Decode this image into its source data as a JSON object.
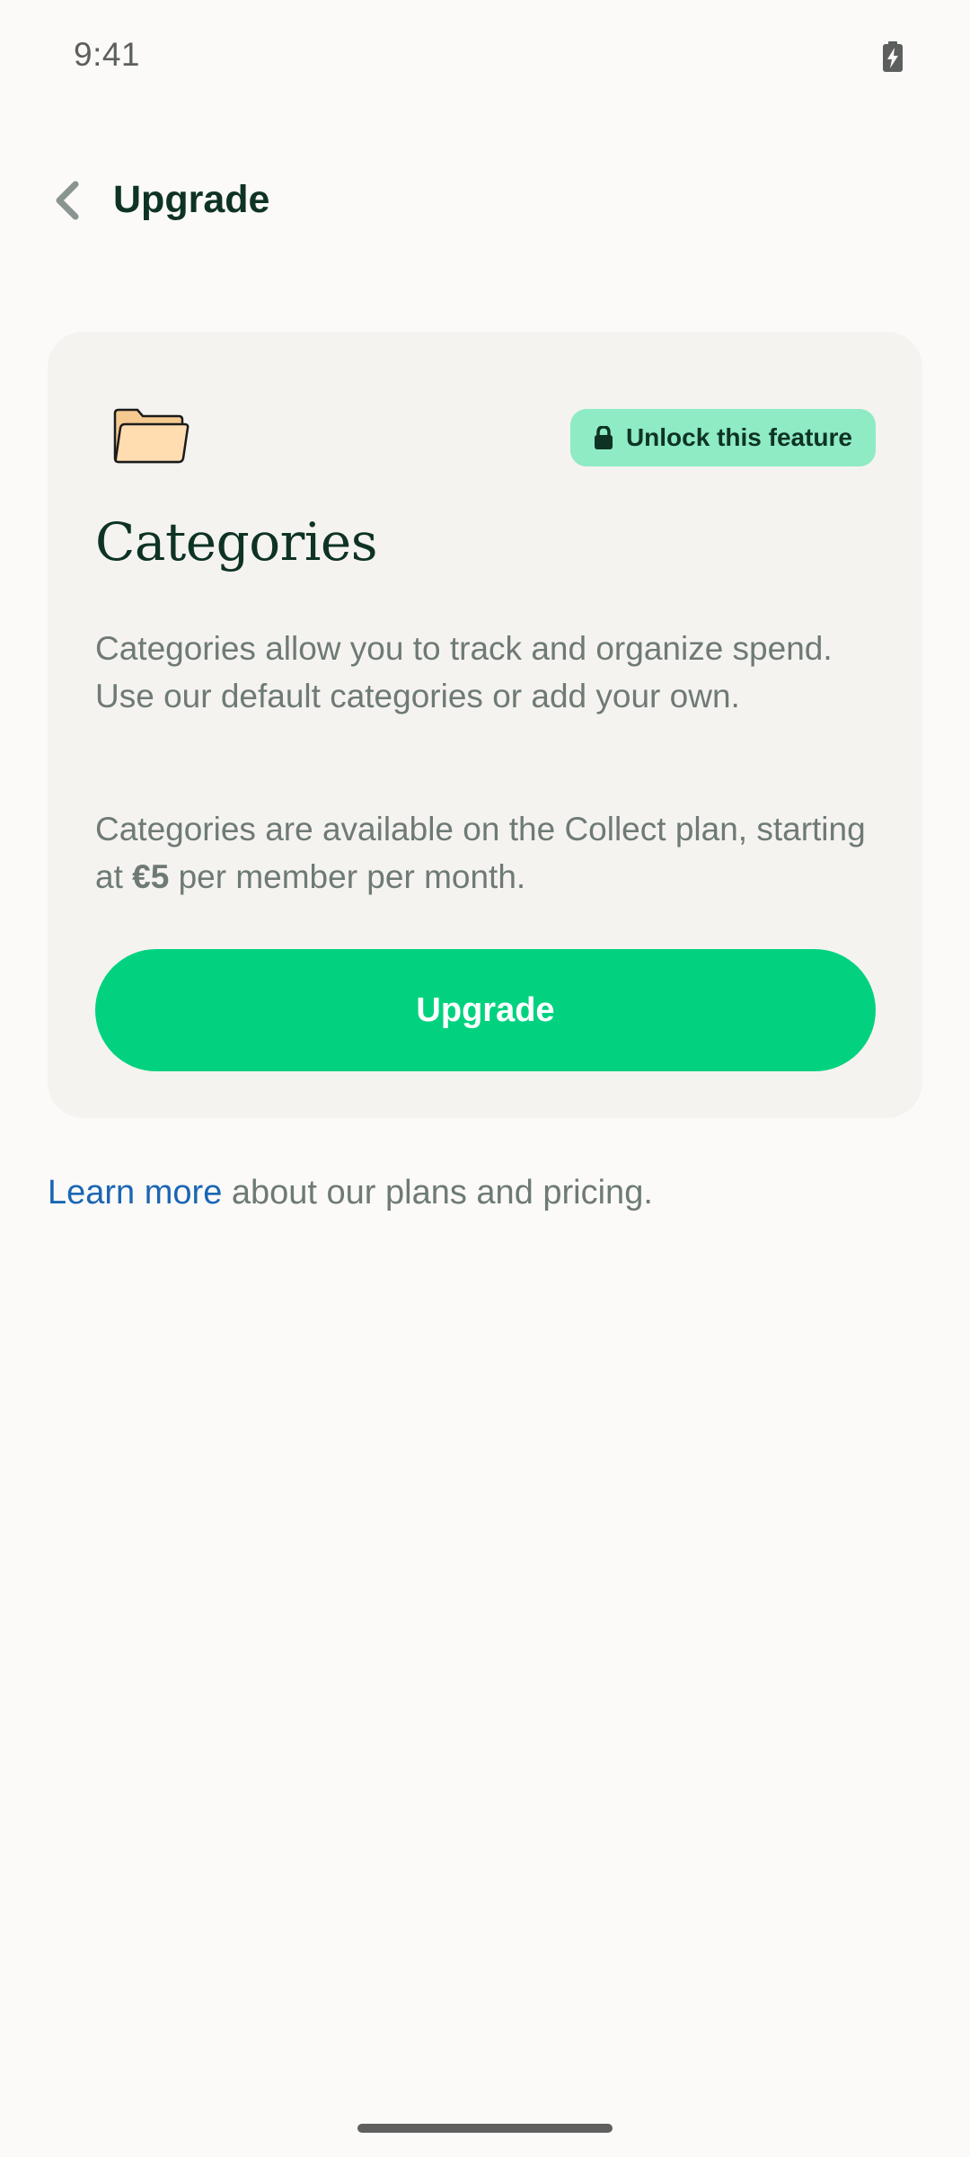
{
  "status_bar": {
    "time": "9:41",
    "battery_icon": "battery-charging-icon"
  },
  "app_bar": {
    "back_icon": "chevron-left-icon",
    "title": "Upgrade"
  },
  "feature_card": {
    "icon": "folder-icon",
    "badge": {
      "icon": "lock-icon",
      "label": "Unlock this feature"
    },
    "title": "Categories",
    "description": "Categories allow you to track and organize spend. Use our default categories or add your own.",
    "pricing_prefix": "Categories are available on the Collect plan, starting at",
    "price": "€5",
    "pricing_suffix": "per member per month.",
    "button_label": "Upgrade"
  },
  "footer": {
    "link_label": "Learn more",
    "text": "about our plans and pricing."
  },
  "colors": {
    "background": "#FBFAF8",
    "card": "#F5F3F0",
    "primary_green": "#02D27F",
    "badge_green": "#8EEBC4",
    "dark_text": "#0E3325",
    "muted_text": "#6E7A75",
    "link": "#1A66B3"
  }
}
